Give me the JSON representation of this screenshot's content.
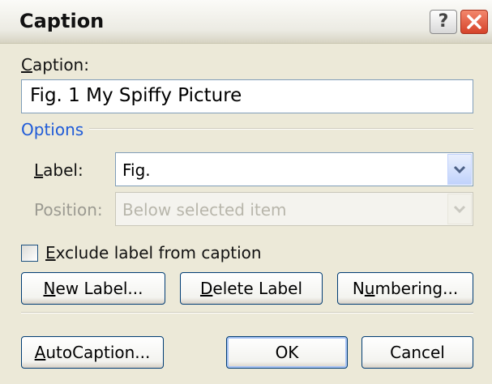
{
  "window": {
    "title": "Caption"
  },
  "caption": {
    "label_mn": "C",
    "label_rest": "aption:",
    "value": "Fig. 1 My Spiffy Picture"
  },
  "options": {
    "group_label": "Options",
    "label_field": {
      "label_mn": "L",
      "label_rest": "abel:",
      "value": "Fig."
    },
    "position_field": {
      "label": "Position:",
      "value": "Below selected item",
      "disabled": true
    }
  },
  "exclude_checkbox": {
    "label_mn": "E",
    "label_rest": "xclude label from caption",
    "checked": false
  },
  "buttons": {
    "new_label": {
      "mn": "N",
      "rest": "ew Label..."
    },
    "delete_label": {
      "mn": "D",
      "rest": "elete Label"
    },
    "numbering_pre": "N",
    "numbering_mn": "u",
    "numbering_rest": "mbering...",
    "autocaption": {
      "mn": "A",
      "rest": "utoCaption..."
    },
    "ok": "OK",
    "cancel": "Cancel"
  }
}
